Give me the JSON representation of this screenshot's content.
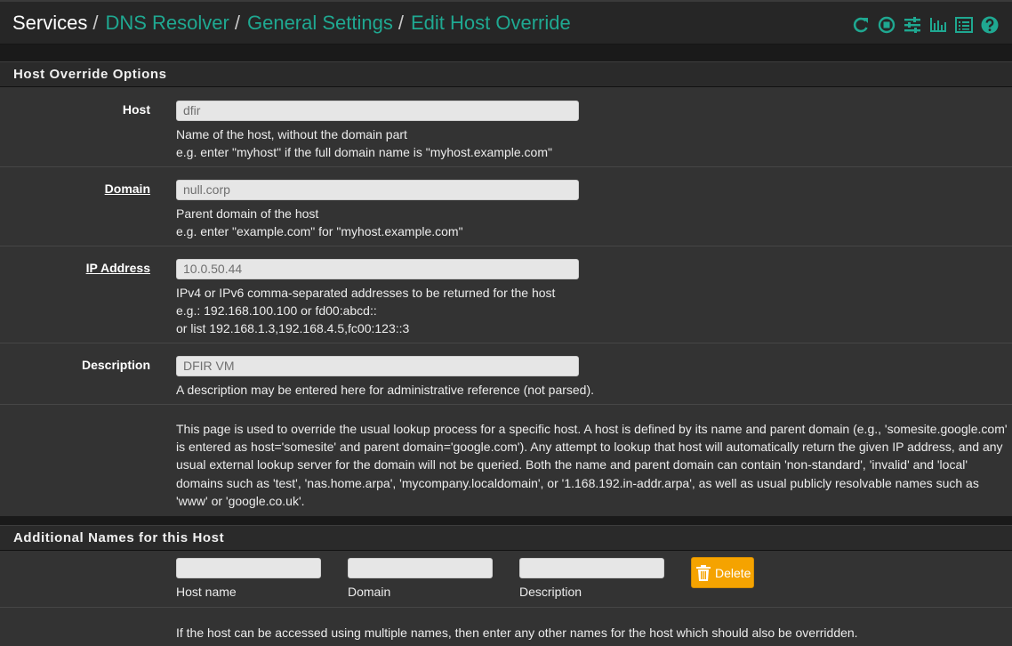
{
  "breadcrumb": {
    "root": "Services",
    "items": [
      "DNS Resolver",
      "General Settings",
      "Edit Host Override"
    ],
    "separator": "/"
  },
  "header_icons": [
    "reload-icon",
    "stop-icon",
    "settings-sliders-icon",
    "bar-chart-icon",
    "log-list-icon",
    "help-icon"
  ],
  "colors": {
    "accent": "#1fa891",
    "warning": "#f5a300"
  },
  "host_override": {
    "heading": "Host Override Options",
    "host": {
      "label": "Host",
      "value": "dfir",
      "help1": "Name of the host, without the domain part",
      "help2": "e.g. enter \"myhost\" if the full domain name is \"myhost.example.com\""
    },
    "domain": {
      "label": "Domain",
      "value": "null.corp",
      "help1": "Parent domain of the host",
      "help2": "e.g. enter \"example.com\" for \"myhost.example.com\""
    },
    "ip": {
      "label": "IP Address",
      "value": "10.0.50.44",
      "help1": "IPv4 or IPv6 comma-separated addresses to be returned for the host",
      "help2": "e.g.: 192.168.100.100 or fd00:abcd::",
      "help3": "or list 192.168.1.3,192.168.4.5,fc00:123::3"
    },
    "description": {
      "label": "Description",
      "value": "DFIR VM",
      "help1": "A description may be entered here for administrative reference (not parsed)."
    },
    "info": "This page is used to override the usual lookup process for a specific host. A host is defined by its name and parent domain (e.g., 'somesite.google.com' is entered as host='somesite' and parent domain='google.com'). Any attempt to lookup that host will automatically return the given IP address, and any usual external lookup server for the domain will not be queried. Both the name and parent domain can contain 'non-standard', 'invalid' and 'local' domains such as 'test', 'nas.home.arpa', 'mycompany.localdomain', or '1.168.192.in-addr.arpa', as well as usual publicly resolvable names such as 'www' or 'google.co.uk'."
  },
  "additional_names": {
    "heading": "Additional Names for this Host",
    "host_name_label": "Host name",
    "domain_label": "Domain",
    "description_label": "Description",
    "host_name_value": "",
    "domain_value": "",
    "description_value": "",
    "delete_label": "Delete",
    "info": "If the host can be accessed using multiple names, then enter any other names for the host which should also be overridden."
  }
}
